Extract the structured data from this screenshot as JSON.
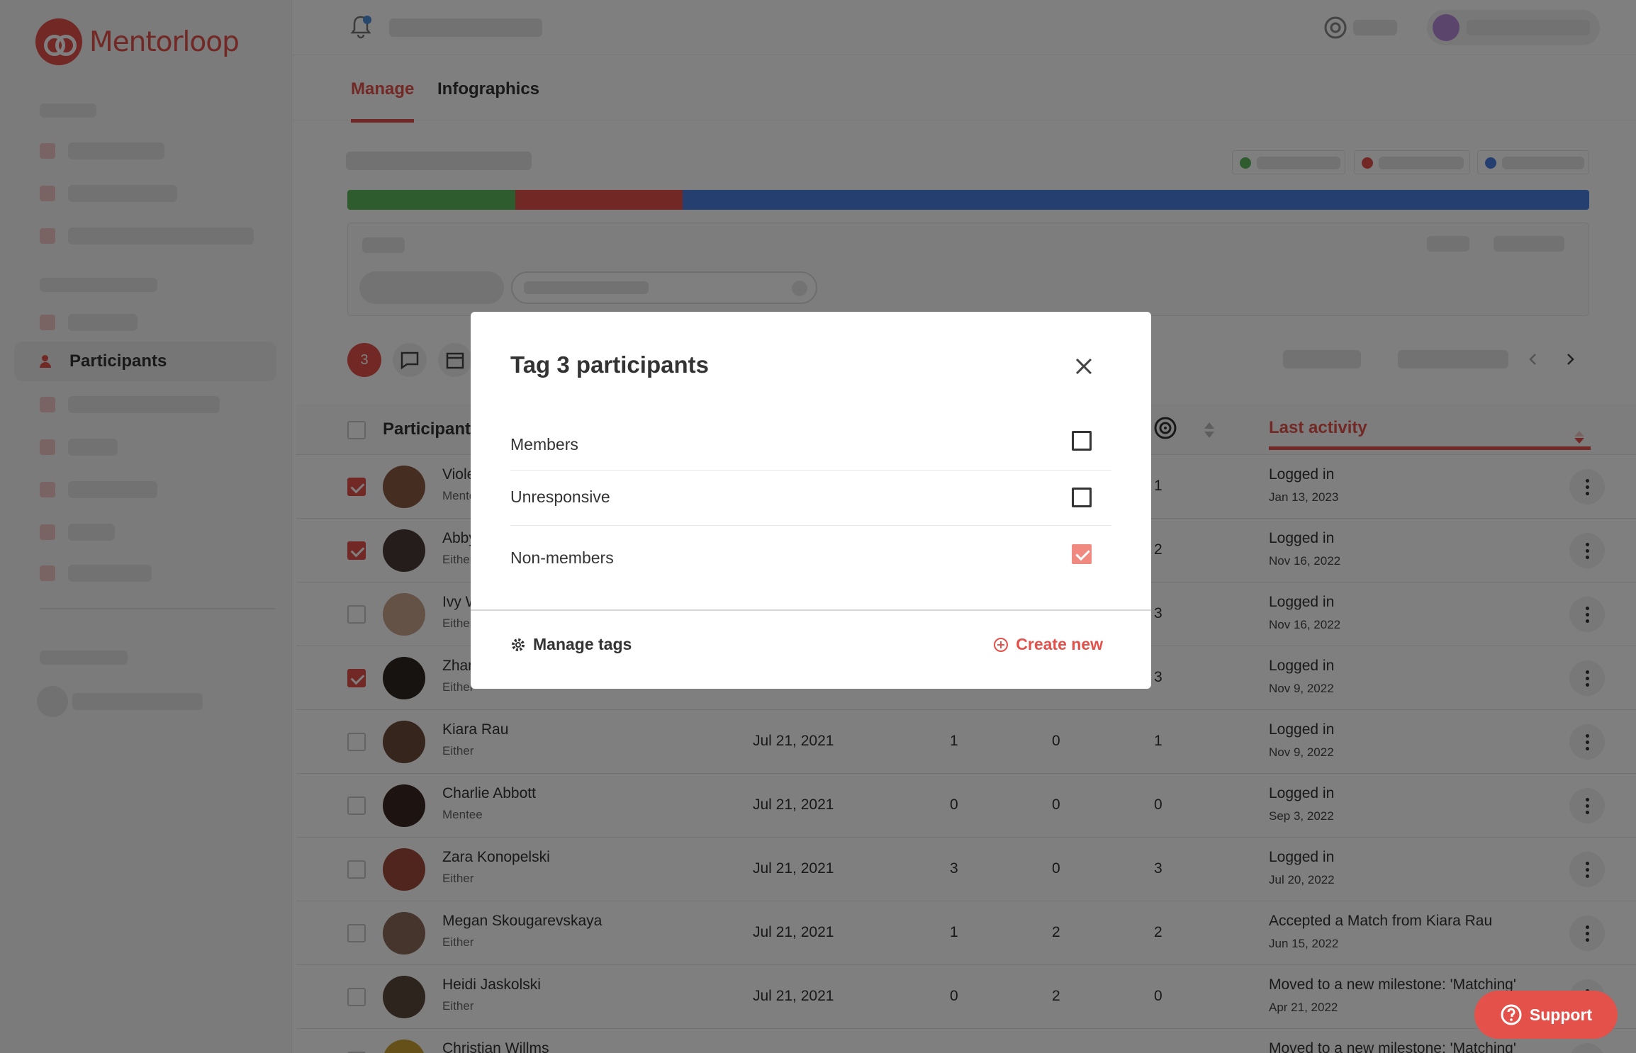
{
  "brand": {
    "logo_text": "Mentorloop"
  },
  "sidebar": {
    "active_item": "Participants"
  },
  "tabs": [
    {
      "label": "Manage"
    },
    {
      "label": "Infographics"
    }
  ],
  "toolbar": {
    "selected_count": "3"
  },
  "table": {
    "header": {
      "participant": "Participants",
      "last_activity": "Last activity"
    },
    "rows": [
      {
        "name": "Violet",
        "role": "Mentor",
        "date": "",
        "c1": "",
        "c2": "",
        "c3": "1",
        "activity": "Logged in",
        "activity_date": "Jan 13, 2023",
        "checked": true,
        "avatar": "#8a5a44"
      },
      {
        "name": "Abby",
        "role": "Either",
        "date": "",
        "c1": "",
        "c2": "",
        "c3": "2",
        "activity": "Logged in",
        "activity_date": "Nov 16, 2022",
        "checked": true,
        "avatar": "#4a3a36"
      },
      {
        "name": "Ivy W",
        "role": "Either",
        "date": "",
        "c1": "",
        "c2": "",
        "c3": "3",
        "activity": "Logged in",
        "activity_date": "Nov 16, 2022",
        "checked": false,
        "avatar": "#c9a58f"
      },
      {
        "name": "Zhan",
        "role": "Either",
        "date": "",
        "c1": "",
        "c2": "",
        "c3": "3",
        "activity": "Logged in",
        "activity_date": "Nov 9, 2022",
        "checked": true,
        "avatar": "#2f2623"
      },
      {
        "name": "Kiara Rau",
        "role": "Either",
        "date": "Jul 21, 2021",
        "c1": "1",
        "c2": "0",
        "c3": "1",
        "activity": "Logged in",
        "activity_date": "Nov 9, 2022",
        "checked": false,
        "avatar": "#6b4a3a"
      },
      {
        "name": "Charlie Abbott",
        "role": "Mentee",
        "date": "Jul 21, 2021",
        "c1": "0",
        "c2": "0",
        "c3": "0",
        "activity": "Logged in",
        "activity_date": "Sep 3, 2022",
        "checked": false,
        "avatar": "#3a2620"
      },
      {
        "name": "Zara Konopelski",
        "role": "Either",
        "date": "Jul 21, 2021",
        "c1": "3",
        "c2": "0",
        "c3": "3",
        "activity": "Logged in",
        "activity_date": "Jul 20, 2022",
        "checked": false,
        "avatar": "#a04a3c"
      },
      {
        "name": "Megan Skougarevskaya",
        "role": "Either",
        "date": "Jul 21, 2021",
        "c1": "1",
        "c2": "2",
        "c3": "2",
        "activity": "Accepted a Match from Kiara Rau",
        "activity_date": "Jun 15, 2022",
        "checked": false,
        "avatar": "#8a6a58"
      },
      {
        "name": "Heidi Jaskolski",
        "role": "Either",
        "date": "Jul 21, 2021",
        "c1": "0",
        "c2": "2",
        "c3": "0",
        "activity": "Moved to a new milestone: 'Matching'",
        "activity_date": "Apr 21, 2022",
        "checked": false,
        "avatar": "#5a4a3a"
      },
      {
        "name": "Christian Willms",
        "role": "",
        "date": "",
        "c1": "",
        "c2": "",
        "c3": "",
        "activity": "Moved to a new milestone: 'Matching'",
        "activity_date": "",
        "checked": false,
        "avatar": "#c9a030"
      }
    ]
  },
  "progress": {
    "segments": [
      {
        "color": "#5cb85c",
        "fraction": 0.135
      },
      {
        "color": "#e4514b",
        "fraction": 0.135
      },
      {
        "color": "#4a7fe0",
        "fraction": 0.73
      }
    ]
  },
  "modal": {
    "title": "Tag 3 participants",
    "options": [
      {
        "label": "Members",
        "checked": false
      },
      {
        "label": "Unresponsive",
        "checked": false
      },
      {
        "label": "Non-members",
        "checked": true
      }
    ],
    "manage_tags": "Manage tags",
    "create_new": "Create new"
  },
  "support": {
    "label": "Support"
  },
  "colors": {
    "accent": "#e4514b",
    "overlay": "rgba(0,0,0,0.5)"
  }
}
